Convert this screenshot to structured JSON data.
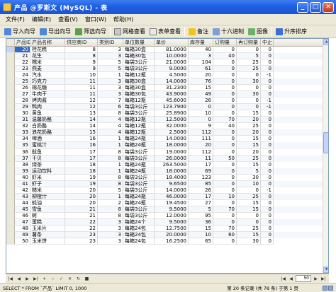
{
  "window": {
    "title": "产品 @罗斯文 (MySQL) - 表"
  },
  "menu": [
    "文件(F)",
    "编辑(E)",
    "查看(V)",
    "窗口(W)",
    "帮助(H)"
  ],
  "toolbar": {
    "import": "导入向导",
    "export": "导出向导",
    "filter": "筛选向导",
    "grid_view": "网格查看",
    "form_view": "表单查看",
    "memo": "备注",
    "hex": "十六进制",
    "image": "图像",
    "sort": "升序排序"
  },
  "grid": {
    "columns": [
      "产品ID",
      "产品名称",
      "供应商ID",
      "类别ID",
      "单位数量",
      "单价",
      "库存量",
      "订购量",
      "再订购量",
      "中止"
    ],
    "rows": [
      [
        "20",
        "桂花糕",
        "8",
        "3",
        "每箱30盒",
        "81.0000",
        "40",
        "0",
        "0",
        "0"
      ],
      [
        "21",
        "花生",
        "8",
        "3",
        "每箱30包",
        "10.0000",
        "3",
        "40",
        "5",
        "0"
      ],
      [
        "22",
        "糯米",
        "9",
        "5",
        "每袋3公斤",
        "21.0000",
        "104",
        "0",
        "25",
        "0"
      ],
      [
        "23",
        "燕麦",
        "9",
        "5",
        "每袋3公斤",
        "9.0000",
        "61",
        "0",
        "25",
        "0"
      ],
      [
        "24",
        "汽水",
        "10",
        "1",
        "每箱12瓶",
        "4.5000",
        "20",
        "0",
        "0",
        "-1"
      ],
      [
        "25",
        "巧克力",
        "11",
        "3",
        "每箱30盒",
        "14.0000",
        "76",
        "0",
        "30",
        "0"
      ],
      [
        "26",
        "棉花糖",
        "11",
        "3",
        "每箱30盒",
        "31.2300",
        "15",
        "0",
        "0",
        "0"
      ],
      [
        "27",
        "牛肉干",
        "11",
        "3",
        "每箱30包",
        "43.9000",
        "49",
        "0",
        "30",
        "0"
      ],
      [
        "28",
        "烤肉酱",
        "12",
        "7",
        "每箱12瓶",
        "45.6000",
        "26",
        "0",
        "0",
        "-1"
      ],
      [
        "29",
        "鸭肉",
        "12",
        "6",
        "每袋3公斤",
        "123.7900",
        "0",
        "0",
        "0",
        "-1"
      ],
      [
        "30",
        "黄鱼",
        "13",
        "8",
        "每袋3公斤",
        "25.8900",
        "10",
        "0",
        "15",
        "0"
      ],
      [
        "31",
        "温馨奶酪",
        "14",
        "4",
        "每箱12瓶",
        "12.5000",
        "0",
        "70",
        "20",
        "0"
      ],
      [
        "32",
        "白奶酪",
        "14",
        "4",
        "每箱12瓶",
        "32.0000",
        "9",
        "40",
        "25",
        "0"
      ],
      [
        "33",
        "浪花奶酪",
        "15",
        "4",
        "每箱12瓶",
        "2.5000",
        "112",
        "0",
        "20",
        "0"
      ],
      [
        "34",
        "啤酒",
        "16",
        "1",
        "每箱24瓶",
        "14.0000",
        "111",
        "0",
        "15",
        "0"
      ],
      [
        "35",
        "蜜桃汁",
        "16",
        "1",
        "每箱24瓶",
        "18.0000",
        "20",
        "0",
        "15",
        "0"
      ],
      [
        "36",
        "鱿鱼",
        "17",
        "8",
        "每袋3公斤",
        "19.0000",
        "112",
        "0",
        "20",
        "0"
      ],
      [
        "37",
        "干贝",
        "17",
        "8",
        "每袋3公斤",
        "26.0000",
        "11",
        "50",
        "25",
        "0"
      ],
      [
        "38",
        "绿茶",
        "18",
        "1",
        "每箱24瓶",
        "263.5000",
        "17",
        "0",
        "15",
        "0"
      ],
      [
        "39",
        "运动饮料",
        "18",
        "1",
        "每箱24瓶",
        "18.0000",
        "69",
        "0",
        "5",
        "0"
      ],
      [
        "40",
        "虾米",
        "19",
        "8",
        "每袋3公斤",
        "18.4000",
        "123",
        "0",
        "30",
        "0"
      ],
      [
        "41",
        "虾子",
        "19",
        "8",
        "每袋3公斤",
        "9.6500",
        "85",
        "0",
        "10",
        "0"
      ],
      [
        "42",
        "糙米",
        "20",
        "5",
        "每袋3公斤",
        "14.0000",
        "26",
        "0",
        "0",
        "-1"
      ],
      [
        "43",
        "柳橙汁",
        "20",
        "1",
        "每箱24瓶",
        "46.0000",
        "17",
        "10",
        "25",
        "0"
      ],
      [
        "44",
        "蚝油",
        "20",
        "2",
        "每箱24瓶",
        "19.4500",
        "27",
        "0",
        "15",
        "0"
      ],
      [
        "45",
        "雪鱼",
        "21",
        "8",
        "每袋3公斤",
        "9.5000",
        "5",
        "70",
        "15",
        "0"
      ],
      [
        "46",
        "蚵",
        "21",
        "8",
        "每袋3公斤",
        "12.0000",
        "95",
        "0",
        "0",
        "0"
      ],
      [
        "47",
        "蛋糕",
        "22",
        "3",
        "每箱24个",
        "9.5000",
        "36",
        "0",
        "0",
        "0"
      ],
      [
        "48",
        "玉米片",
        "22",
        "3",
        "每箱24包",
        "12.7500",
        "15",
        "70",
        "25",
        "0"
      ],
      [
        "49",
        "薯条",
        "23",
        "3",
        "每箱24包",
        "20.0000",
        "10",
        "60",
        "15",
        "0"
      ],
      [
        "50",
        "玉米饼",
        "23",
        "3",
        "每箱24包",
        "16.2500",
        "65",
        "0",
        "30",
        "0"
      ]
    ]
  },
  "nav": {
    "page": "50"
  },
  "status": {
    "sql": "SELECT * FROM `产品` LIMIT 0, 1000",
    "records": "第 20 条记录 (共 78 条) 于第 1 页"
  }
}
